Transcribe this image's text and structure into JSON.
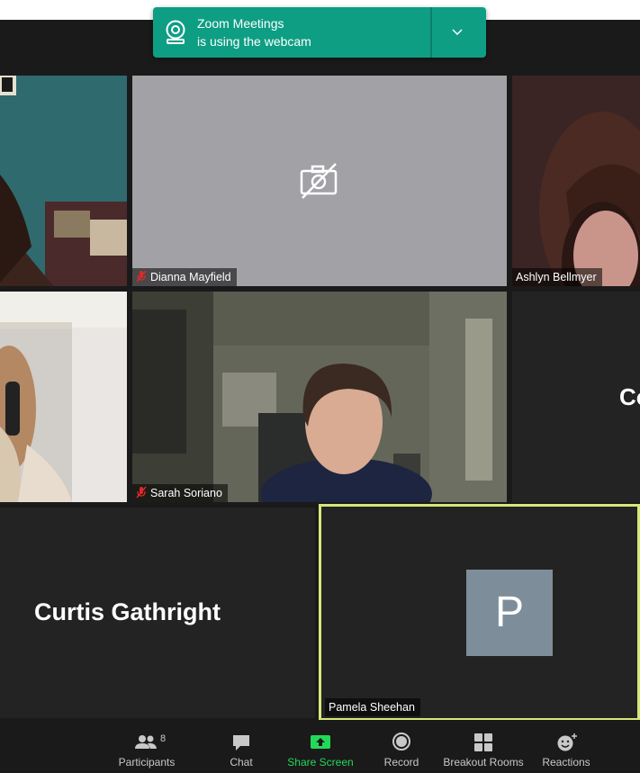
{
  "notification": {
    "line1": "Zoom Meetings",
    "line2": "is using the webcam"
  },
  "tiles": {
    "dianna": {
      "name": "Dianna Mayfield",
      "muted": true,
      "video_off": true
    },
    "ashlyn": {
      "name": "Ashlyn Bellmyer",
      "muted": false
    },
    "sarah": {
      "name": "Sarah Soriano",
      "muted": true
    },
    "partial_right": {
      "name_fragment": "Co"
    },
    "curtis": {
      "name": "Curtis Gathright"
    },
    "pamela": {
      "name": "Pamela Sheehan",
      "avatar_initial": "P",
      "active_speaker": true
    }
  },
  "toolbar": {
    "participants": {
      "label": "Participants",
      "count": "8"
    },
    "chat": {
      "label": "Chat"
    },
    "share": {
      "label": "Share Screen"
    },
    "record": {
      "label": "Record"
    },
    "breakout": {
      "label": "Breakout Rooms"
    },
    "reactions": {
      "label": "Reactions"
    }
  },
  "colors": {
    "notification": "#0e9e84",
    "share_green": "#23d959",
    "active_border": "#d6e87a",
    "avatar_bg": "#7d8e9a",
    "mute_red": "#e02828"
  }
}
